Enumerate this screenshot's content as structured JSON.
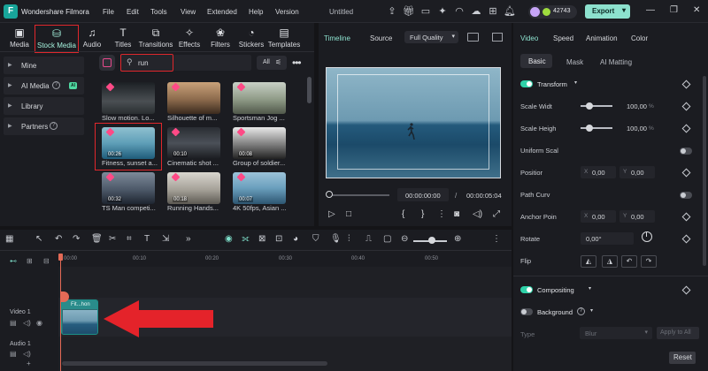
{
  "app": {
    "logo_letter": "F",
    "name": "Wondershare Filmora",
    "menu": [
      "File",
      "Edit",
      "Tools",
      "View",
      "Extended",
      "Help",
      "Version"
    ],
    "document_title": "Untitled",
    "credits": "42743",
    "export_label": "Export",
    "accent_color": "#8de1ce",
    "highlight_color": "#e0272c"
  },
  "media_tabs": [
    {
      "label": "Media",
      "icon": "media-icon"
    },
    {
      "label": "Stock Media",
      "icon": "stock-media-icon"
    },
    {
      "label": "Audio",
      "icon": "audio-icon"
    },
    {
      "label": "Titles",
      "icon": "titles-icon"
    },
    {
      "label": "Transitions",
      "icon": "transitions-icon"
    },
    {
      "label": "Effects",
      "icon": "effects-icon"
    },
    {
      "label": "Filters",
      "icon": "filters-icon"
    },
    {
      "label": "Stickers",
      "icon": "stickers-icon"
    },
    {
      "label": "Templates",
      "icon": "templates-icon"
    }
  ],
  "sidebar": {
    "items": [
      {
        "label": "Mine"
      },
      {
        "label": "AI Media",
        "badge": "AI"
      },
      {
        "label": "Library"
      },
      {
        "label": "Partners"
      }
    ]
  },
  "search": {
    "value": "run",
    "filter_label": "All"
  },
  "thumbnails": [
    {
      "caption": "Slow motion. Lo...",
      "duration": ""
    },
    {
      "caption": "Silhouette of m...",
      "duration": ""
    },
    {
      "caption": "Sportsman Jog ...",
      "duration": ""
    },
    {
      "caption": "Fitness, sunset a...",
      "duration": "00:26"
    },
    {
      "caption": "Cinematic shot ...",
      "duration": "00:10"
    },
    {
      "caption": "Group of soldier...",
      "duration": "00:08"
    },
    {
      "caption": "TS Man competi...",
      "duration": "00:32"
    },
    {
      "caption": "Running Hands...",
      "duration": "00:18"
    },
    {
      "caption": "4K 50fps, Asian ...",
      "duration": "00:07"
    }
  ],
  "preview": {
    "tabs": [
      "Timeline",
      "Source"
    ],
    "quality": "Full Quality",
    "current_time": "00:00:00:00",
    "separator": "/",
    "total_time": "00:00:05:04"
  },
  "properties": {
    "tabs": [
      "Video",
      "Speed",
      "Animation",
      "Color"
    ],
    "subtabs": [
      "Basic",
      "Mask",
      "AI Matting"
    ],
    "transform_label": "Transform",
    "scale_width_label": "Scale Widt",
    "scale_width_value": "100,00",
    "scale_height_label": "Scale Heigh",
    "scale_height_value": "100,00",
    "percent_unit": "%",
    "uniform_scale_label": "Uniform Scal",
    "position_label": "Positior",
    "position_x": "0,00",
    "position_y": "0,00",
    "x_label": "X",
    "y_label": "Y",
    "path_curve_label": "Path Curv",
    "anchor_label": "Anchor Poin",
    "anchor_x": "0,00",
    "anchor_y": "0,00",
    "rotate_label": "Rotate",
    "rotate_value": "0,00°",
    "flip_label": "Flip",
    "compositing_label": "Compositing",
    "background_label": "Background",
    "type_label": "Type",
    "type_value": "Blur",
    "apply_all_label": "Apply to All",
    "reset_label": "Reset"
  },
  "timeline": {
    "ruler_ticks": [
      "00:00",
      "00:10",
      "00:20",
      "00:30",
      "00:40",
      "00:50"
    ],
    "tracks": [
      {
        "label": "Video 1"
      },
      {
        "label": "Audio 1"
      }
    ],
    "clip_label": "Fit...hon"
  }
}
